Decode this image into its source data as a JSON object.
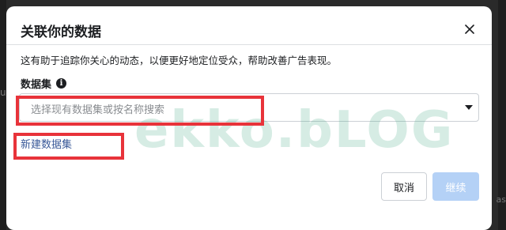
{
  "dialog": {
    "title": "关联你的数据",
    "description": "这有助于追踪你关心的动态，以便更好地定位受众，帮助改善广告表现。",
    "close_icon": "close-icon"
  },
  "dataset_field": {
    "label": "数据集",
    "info_icon": "info-icon",
    "placeholder": "选择现有数据集或按名称搜索",
    "dropdown_icon": "caret-down-icon"
  },
  "create_link": {
    "label": "新建数据集"
  },
  "footer": {
    "cancel_label": "取消",
    "continue_label": "继续"
  },
  "watermark": {
    "text": "ekko.bLOG"
  },
  "backdrop": {
    "left_glyph": "u",
    "right_glyph": "as"
  },
  "colors": {
    "link": "#385898",
    "highlight": "#e8333a",
    "primary_disabled": "#b4d1f6",
    "watermark": "#46aa82"
  }
}
